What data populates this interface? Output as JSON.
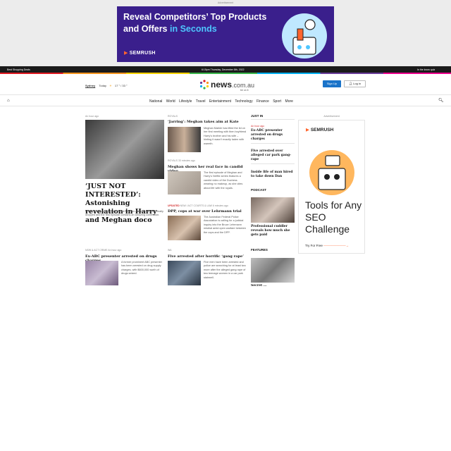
{
  "advertisement_top": {
    "label": "Advertisement",
    "headline_part1": "Reveal Competitors’ Top Products and Offers ",
    "headline_accent": "in Seconds",
    "brand": "SEMRUSH",
    "colors": {
      "bg": "#3a1f8c",
      "accent": "#4ec6ff",
      "brand_mark": "#ff642d"
    }
  },
  "topbar": {
    "left": "Best Shopping Deals",
    "center": "6:15pm Thursday, December 8th, 2022",
    "right": "In the know quiz"
  },
  "header": {
    "location": "Sydney",
    "today_label": "Today",
    "weather_icon": "sun-cloud-icon",
    "temps": "17 ° / 33 °",
    "logo_text": "news",
    "logo_domain": ".com.au",
    "logo_tagline": "be on it",
    "signup": "Sign Up",
    "login": "Log in"
  },
  "nav": {
    "items": [
      "National",
      "World",
      "Lifestyle",
      "Travel",
      "Entertainment",
      "Technology",
      "Finance",
      "Sport",
      "More"
    ]
  },
  "lead_story": {
    "time": "An hour ago",
    "headline": "‘JUST NOT INTERESTED’: Astonishing revelation in Harry and Meghan doco",
    "summary": "Prince Harry and Meghan Markle’s Netflix documentary has finally dropped and the first episode contains an amazing confession."
  },
  "stories": [
    {
      "category": "ROYALS",
      "headline": "‘Jarring’: Meghan takes aim at Kate",
      "summary": "Meghan Markle has lifted the lid on her first meeting with then boyfriend Harry’s brother and his wife – hinting it wasn’t exactly laden with warmth."
    },
    {
      "category": "ROYALS",
      "time": "33 minutes ago",
      "headline": "Meghan shows her real face in candid video",
      "summary": "The first episode of Meghan and Harry’s Netflix series features a candid video of the Duchess wearing no makeup, as she cites about life with the royals."
    },
    {
      "flag": "UPDATED",
      "category": "NSW / ACT COURTS & LAW",
      "time": "6 minutes ago",
      "headline": "DPP, cops at war over Lehrmann trial",
      "summary": "The Australian Federal Police Association is calling for a judicial inquiry into the Bruce Lehrmann mistrial amid open warfare between the cops and the DPP."
    }
  ],
  "lower_stories": [
    {
      "category": "NSW & ACT CRIME",
      "time": "An hour ago",
      "headline": "Ex-ABC presenter arrested on drugs charges",
      "summary": "A former prominent ABC presenter has been arrested on drug supply charges, with $600,000 worth of drugs seized."
    },
    {
      "category": "WA",
      "headline": "Five arrested after horrific ‘gang rape’",
      "summary": "Five men have been arrested and police are searching for at least two more after the alleged gang rape of two teenage women in a car park stairwell."
    }
  ],
  "just_in": {
    "title": "JUST IN",
    "items": [
      {
        "time": "An hour ago",
        "headline": "Ex-ABC presenter arrested on drugs charges"
      },
      {
        "headline": "Five arrested over alleged car park gang-rape"
      },
      {
        "headline": "Inside life of man hired to take down Dan"
      }
    ]
  },
  "podcast": {
    "title": "PODCAST",
    "headline": "Professional cuddler reveals how much she gets paid"
  },
  "features": {
    "title": "FEATURES",
    "cutoff": "Secret ..."
  },
  "advertisement_right": {
    "label": "Advertisement",
    "brand": "SEMRUSH",
    "headline": "Tools for Any SEO Challenge",
    "cta": "Try For Free"
  }
}
